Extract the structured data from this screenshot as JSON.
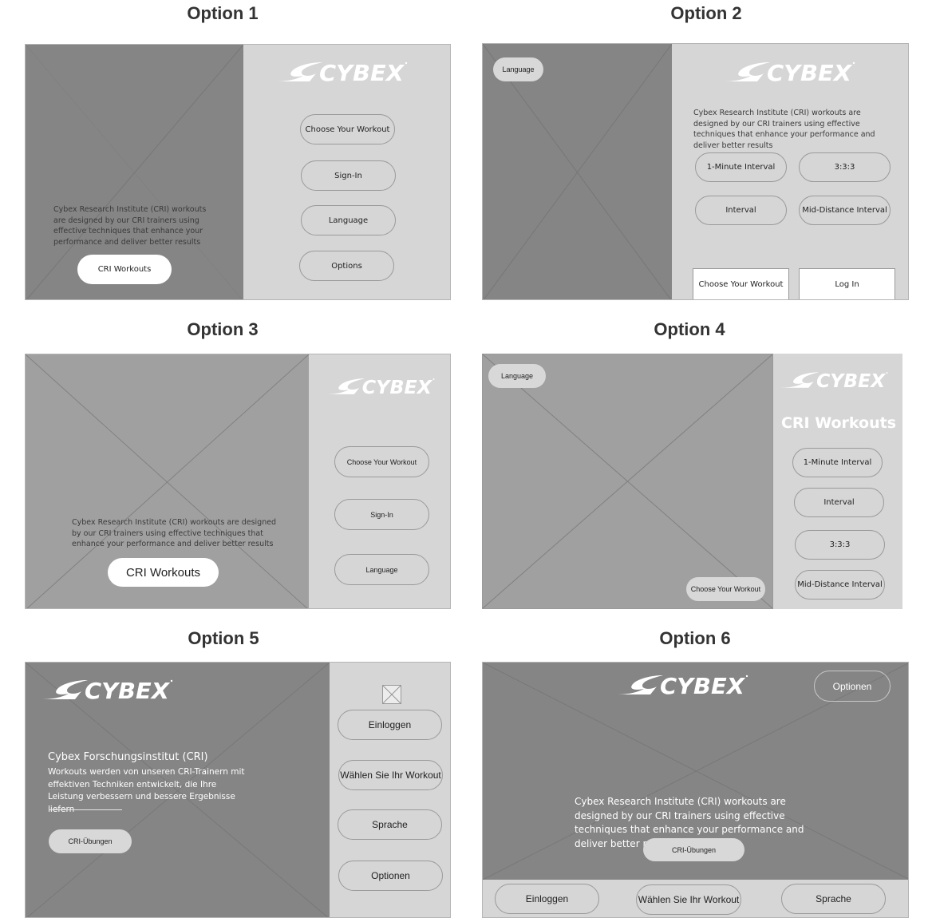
{
  "brand": {
    "logo_text": "CYBEX"
  },
  "options": [
    {
      "title": "Option 1",
      "description": "Cybex Research Institute (CRI) workouts are designed by our CRI trainers using effective techniques that enhance your performance and deliver better results",
      "cta": "CRI Workouts",
      "menu": [
        "Choose Your Workout",
        "Sign-In",
        "Language",
        "Options"
      ]
    },
    {
      "title": "Option 2",
      "language_button": "Language",
      "description": "Cybex Research Institute (CRI) workouts are designed by our CRI trainers using effective techniques that enhance your performance and deliver better results",
      "workouts": [
        "1-Minute Interval",
        "3:3:3",
        "Interval",
        "Mid-Distance Interval"
      ],
      "bottom_buttons": [
        "Choose Your Workout",
        "Log In"
      ]
    },
    {
      "title": "Option 3",
      "description": "Cybex Research Institute (CRI) workouts are designed by our CRI trainers using effective techniques that enhance your performance and deliver better results",
      "cta": "CRI Workouts",
      "menu": [
        "Choose Your Workout",
        "Sign-In",
        "Language"
      ]
    },
    {
      "title": "Option 4",
      "language_button": "Language",
      "choose_button": "Choose Your Workout",
      "heading": "CRI Workouts",
      "workouts": [
        "1-Minute Interval",
        "Interval",
        "3:3:3",
        "Mid-Distance Interval"
      ]
    },
    {
      "title": "Option 5",
      "heading": "Cybex Forschungsinstitut (CRI)",
      "description": "Workouts werden von unseren CRI-Trainern mit effektiven Techniken entwickelt, die Ihre Leistung verbessern und bessere Ergebnisse liefern",
      "cta": "CRI-Übungen",
      "menu": [
        "Einloggen",
        "Wählen Sie Ihr Workout",
        "Sprache",
        "Optionen"
      ]
    },
    {
      "title": "Option 6",
      "options_button": "Optionen",
      "description": "Cybex Research Institute (CRI) workouts are designed by our CRI trainers using effective techniques that enhance your performance and deliver better results",
      "cta": "CRI-Übungen",
      "bottom_buttons": [
        "Einloggen",
        "Wählen Sie Ihr Workout",
        "Sprache"
      ]
    }
  ]
}
